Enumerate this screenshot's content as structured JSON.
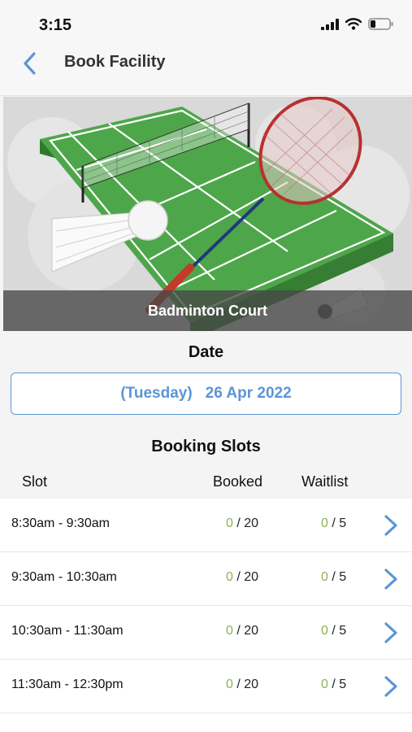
{
  "status_bar": {
    "time": "3:15"
  },
  "nav": {
    "title": "Book Facility"
  },
  "facility": {
    "name": "Badminton Court"
  },
  "date": {
    "title": "Date",
    "weekday": "(Tuesday)",
    "value": "26 Apr 2022"
  },
  "slots": {
    "title": "Booking Slots",
    "headers": {
      "slot": "Slot",
      "booked": "Booked",
      "waitlist": "Waitlist"
    },
    "rows": [
      {
        "time": "8:30am - 9:30am",
        "booked": "0",
        "booked_cap": "/ 20",
        "waitlist": "0",
        "waitlist_cap": "/ 5"
      },
      {
        "time": "9:30am - 10:30am",
        "booked": "0",
        "booked_cap": "/ 20",
        "waitlist": "0",
        "waitlist_cap": "/ 5"
      },
      {
        "time": "10:30am - 11:30am",
        "booked": "0",
        "booked_cap": "/ 20",
        "waitlist": "0",
        "waitlist_cap": "/ 5"
      },
      {
        "time": "11:30am - 12:30pm",
        "booked": "0",
        "booked_cap": "/ 20",
        "waitlist": "0",
        "waitlist_cap": "/ 5"
      }
    ]
  },
  "colors": {
    "accent": "#5b95d6",
    "available": "#8db254",
    "court_green": "#4ea64a"
  },
  "icons": [
    "signal-icon",
    "wifi-icon",
    "battery-icon",
    "back-chevron-icon",
    "chevron-right-icon"
  ]
}
